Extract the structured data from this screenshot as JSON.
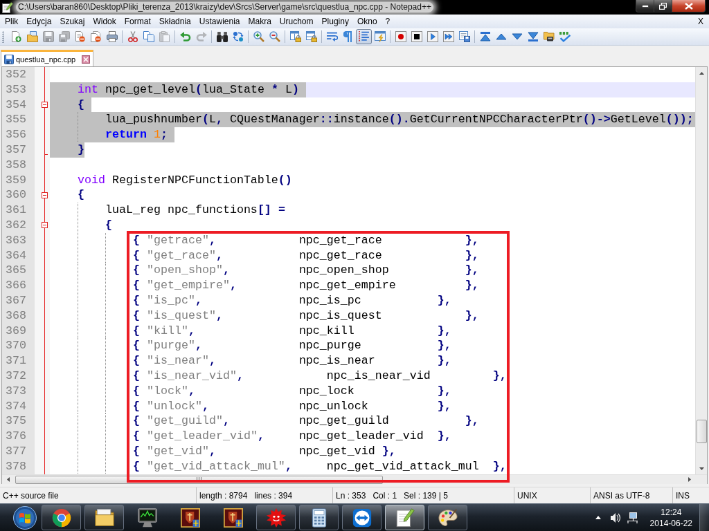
{
  "window": {
    "title": "C:\\Users\\baran860\\Desktop\\Pliki_terenza_2013\\kraizy\\dev\\Srcs\\Server\\game\\src\\questlua_npc.cpp - Notepad++"
  },
  "menu": [
    "Plik",
    "Edycja",
    "Szukaj",
    "Widok",
    "Format",
    "Składnia",
    "Ustawienia",
    "Makra",
    "Uruchom",
    "Pluginy",
    "Okno",
    "?"
  ],
  "menu_close": "X",
  "toolbar": [
    {
      "kind": "new",
      "disabled": false
    },
    {
      "kind": "open",
      "disabled": false
    },
    {
      "kind": "save",
      "disabled": true
    },
    {
      "kind": "saveall",
      "disabled": true
    },
    {
      "kind": "close",
      "disabled": false
    },
    {
      "kind": "closeall",
      "disabled": false
    },
    {
      "kind": "print",
      "disabled": false
    },
    {
      "kind": "separator"
    },
    {
      "kind": "cut",
      "disabled": false
    },
    {
      "kind": "copy",
      "disabled": false
    },
    {
      "kind": "paste",
      "disabled": true
    },
    {
      "kind": "separator"
    },
    {
      "kind": "undo",
      "disabled": false
    },
    {
      "kind": "redo",
      "disabled": true
    },
    {
      "kind": "separator"
    },
    {
      "kind": "find",
      "disabled": false
    },
    {
      "kind": "replace",
      "disabled": false
    },
    {
      "kind": "separator"
    },
    {
      "kind": "zoomin",
      "disabled": false
    },
    {
      "kind": "zoomout",
      "disabled": false
    },
    {
      "kind": "separator"
    },
    {
      "kind": "syncv",
      "disabled": false,
      "on": false
    },
    {
      "kind": "synch",
      "disabled": false,
      "on": false
    },
    {
      "kind": "separator"
    },
    {
      "kind": "wrap",
      "disabled": false,
      "on": false
    },
    {
      "kind": "allchars",
      "disabled": false,
      "on": false
    },
    {
      "kind": "indentguide",
      "disabled": false,
      "on": true
    },
    {
      "kind": "udl",
      "disabled": false
    },
    {
      "kind": "separator"
    },
    {
      "kind": "record",
      "disabled": false
    },
    {
      "kind": "stop",
      "disabled": false
    },
    {
      "kind": "play",
      "disabled": false
    },
    {
      "kind": "playmulti",
      "disabled": false
    },
    {
      "kind": "savemacro",
      "disabled": false
    },
    {
      "kind": "separator"
    },
    {
      "kind": "first",
      "disabled": false
    },
    {
      "kind": "up",
      "disabled": false
    },
    {
      "kind": "down",
      "disabled": false
    },
    {
      "kind": "last",
      "disabled": false
    },
    {
      "kind": "folder",
      "disabled": false
    },
    {
      "kind": "spell",
      "disabled": false
    }
  ],
  "tabs": [
    {
      "label": "questlua_npc.cpp",
      "selected": true,
      "modified": false
    }
  ],
  "editor": {
    "lines": [
      {
        "kind": "line",
        "number": "352",
        "current": false,
        "selected": false
      },
      {
        "kind": "line",
        "number": "353",
        "current": true,
        "selected": true,
        "segments": [
          {
            "kind": "type",
            "text": "    int"
          },
          {
            "kind": "plain",
            "text": " npc_get_level(lua_State * L)"
          }
        ]
      },
      {
        "kind": "foldstart",
        "number": "354",
        "current": false,
        "selected": true,
        "segments": [
          {
            "kind": "plain",
            "text": "    {"
          }
        ]
      },
      {
        "kind": "line",
        "number": "355",
        "current": false,
        "selected": true,
        "segments": [
          {
            "kind": "plain",
            "text": "        lua_pushnumber(L, CQuestManager::instance().GetCurrentNPCCharacterPtr()->GetLevel());"
          }
        ]
      },
      {
        "kind": "line",
        "number": "356",
        "current": false,
        "selected": true,
        "segments": [
          {
            "kind": "keyword",
            "text": "        return"
          },
          {
            "kind": "number",
            "text": " 1"
          },
          {
            "kind": "plain",
            "text": ";"
          }
        ]
      },
      {
        "kind": "foldend",
        "number": "357",
        "current": false,
        "selected": true,
        "segments": [
          {
            "kind": "plain",
            "text": "    }"
          }
        ]
      },
      {
        "kind": "line",
        "number": "358",
        "current": false,
        "selected": false
      },
      {
        "kind": "line",
        "number": "359",
        "current": false,
        "selected": false,
        "segments": [
          {
            "kind": "type",
            "text": "    void"
          },
          {
            "kind": "plain",
            "text": " RegisterNPCFunctionTable()"
          }
        ]
      },
      {
        "kind": "foldstart",
        "number": "360",
        "current": false,
        "selected": false,
        "segments": [
          {
            "kind": "plain",
            "text": "    {"
          }
        ]
      },
      {
        "kind": "line",
        "number": "361",
        "current": false,
        "selected": false,
        "segments": [
          {
            "kind": "plain",
            "text": "        luaL_reg npc_functions[] ="
          }
        ]
      },
      {
        "kind": "foldstart",
        "number": "362",
        "current": false,
        "selected": false,
        "segments": [
          {
            "kind": "plain",
            "text": "        {"
          }
        ]
      },
      {
        "kind": "highlight",
        "lines": [
          {
            "number": "363",
            "current": false,
            "selected": false,
            "segments": [
              {
                "kind": "plain",
                "text": "            { "
              },
              {
                "kind": "string",
                "text": "\"getrace\""
              },
              {
                "kind": "plain",
                "text": ","
              },
              {
                "kind": "plain",
                "text": "            npc_get_race"
              },
              {
                "kind": "plain",
                "text": "            },"
              }
            ]
          },
          {
            "number": "364",
            "current": false,
            "selected": false,
            "segments": [
              {
                "kind": "plain",
                "text": "            { "
              },
              {
                "kind": "string",
                "text": "\"get_race\""
              },
              {
                "kind": "plain",
                "text": ","
              },
              {
                "kind": "plain",
                "text": "           npc_get_race"
              },
              {
                "kind": "plain",
                "text": "            },"
              }
            ]
          },
          {
            "number": "365",
            "current": false,
            "selected": false,
            "segments": [
              {
                "kind": "plain",
                "text": "            { "
              },
              {
                "kind": "string",
                "text": "\"open_shop\""
              },
              {
                "kind": "plain",
                "text": ","
              },
              {
                "kind": "plain",
                "text": "          npc_open_shop"
              },
              {
                "kind": "plain",
                "text": "           },"
              }
            ]
          },
          {
            "number": "366",
            "current": false,
            "selected": false,
            "segments": [
              {
                "kind": "plain",
                "text": "            { "
              },
              {
                "kind": "string",
                "text": "\"get_empire\""
              },
              {
                "kind": "plain",
                "text": ","
              },
              {
                "kind": "plain",
                "text": "         npc_get_empire"
              },
              {
                "kind": "plain",
                "text": "          },"
              }
            ]
          },
          {
            "number": "367",
            "current": false,
            "selected": false,
            "segments": [
              {
                "kind": "plain",
                "text": "            { "
              },
              {
                "kind": "string",
                "text": "\"is_pc\""
              },
              {
                "kind": "plain",
                "text": ","
              },
              {
                "kind": "plain",
                "text": "              npc_is_pc"
              },
              {
                "kind": "plain",
                "text": "           },"
              }
            ]
          },
          {
            "number": "368",
            "current": false,
            "selected": false,
            "segments": [
              {
                "kind": "plain",
                "text": "            { "
              },
              {
                "kind": "string",
                "text": "\"is_quest\""
              },
              {
                "kind": "plain",
                "text": ","
              },
              {
                "kind": "plain",
                "text": "           npc_is_quest"
              },
              {
                "kind": "plain",
                "text": "            },"
              }
            ]
          },
          {
            "number": "369",
            "current": false,
            "selected": false,
            "segments": [
              {
                "kind": "plain",
                "text": "            { "
              },
              {
                "kind": "string",
                "text": "\"kill\""
              },
              {
                "kind": "plain",
                "text": ","
              },
              {
                "kind": "plain",
                "text": "               npc_kill"
              },
              {
                "kind": "plain",
                "text": "            },"
              }
            ]
          },
          {
            "number": "370",
            "current": false,
            "selected": false,
            "segments": [
              {
                "kind": "plain",
                "text": "            { "
              },
              {
                "kind": "string",
                "text": "\"purge\""
              },
              {
                "kind": "plain",
                "text": ","
              },
              {
                "kind": "plain",
                "text": "              npc_purge"
              },
              {
                "kind": "plain",
                "text": "           },"
              }
            ]
          },
          {
            "number": "371",
            "current": false,
            "selected": false,
            "segments": [
              {
                "kind": "plain",
                "text": "            { "
              },
              {
                "kind": "string",
                "text": "\"is_near\""
              },
              {
                "kind": "plain",
                "text": ","
              },
              {
                "kind": "plain",
                "text": "            npc_is_near"
              },
              {
                "kind": "plain",
                "text": "         },"
              }
            ]
          },
          {
            "number": "372",
            "current": false,
            "selected": false,
            "segments": [
              {
                "kind": "plain",
                "text": "            { "
              },
              {
                "kind": "string",
                "text": "\"is_near_vid\""
              },
              {
                "kind": "plain",
                "text": ","
              },
              {
                "kind": "plain",
                "text": "            npc_is_near_vid"
              },
              {
                "kind": "plain",
                "text": "         },"
              }
            ]
          },
          {
            "number": "373",
            "current": false,
            "selected": false,
            "segments": [
              {
                "kind": "plain",
                "text": "            { "
              },
              {
                "kind": "string",
                "text": "\"lock\""
              },
              {
                "kind": "plain",
                "text": ","
              },
              {
                "kind": "plain",
                "text": "               npc_lock"
              },
              {
                "kind": "plain",
                "text": "            },"
              }
            ]
          },
          {
            "number": "374",
            "current": false,
            "selected": false,
            "segments": [
              {
                "kind": "plain",
                "text": "            { "
              },
              {
                "kind": "string",
                "text": "\"unlock\""
              },
              {
                "kind": "plain",
                "text": ","
              },
              {
                "kind": "plain",
                "text": "             npc_unlock"
              },
              {
                "kind": "plain",
                "text": "          },"
              }
            ]
          },
          {
            "number": "375",
            "current": false,
            "selected": false,
            "segments": [
              {
                "kind": "plain",
                "text": "            { "
              },
              {
                "kind": "string",
                "text": "\"get_guild\""
              },
              {
                "kind": "plain",
                "text": ","
              },
              {
                "kind": "plain",
                "text": "          npc_get_guild"
              },
              {
                "kind": "plain",
                "text": "           },"
              }
            ]
          },
          {
            "number": "376",
            "current": false,
            "selected": false,
            "segments": [
              {
                "kind": "plain",
                "text": "            { "
              },
              {
                "kind": "string",
                "text": "\"get_leader_vid\""
              },
              {
                "kind": "plain",
                "text": ","
              },
              {
                "kind": "plain",
                "text": "     npc_get_leader_vid"
              },
              {
                "kind": "plain",
                "text": "  },"
              }
            ]
          },
          {
            "number": "377",
            "current": false,
            "selected": false,
            "segments": [
              {
                "kind": "plain",
                "text": "            { "
              },
              {
                "kind": "string",
                "text": "\"get_vid\""
              },
              {
                "kind": "plain",
                "text": ","
              },
              {
                "kind": "plain",
                "text": "            npc_get_vid"
              },
              {
                "kind": "plain",
                "text": " },"
              }
            ]
          },
          {
            "number": "378",
            "current": false,
            "selected": false,
            "segments": [
              {
                "kind": "plain",
                "text": "            { "
              },
              {
                "kind": "string",
                "text": "\"get_vid_attack_mul\""
              },
              {
                "kind": "plain",
                "text": ","
              },
              {
                "kind": "plain",
                "text": "     npc_get_vid_attack_mul"
              },
              {
                "kind": "plain",
                "text": "  },"
              }
            ]
          }
        ]
      }
    ]
  },
  "status_bar": {
    "file_type": "C++ source file",
    "length": "length : 8794",
    "lines": "lines : 394",
    "line": "Ln : 353",
    "column": "Col : 1",
    "selection": "Sel : 139 | 5",
    "eol": "UNIX",
    "encoding": "ANSI as UTF-8",
    "mode": "INS"
  },
  "taskbar": {
    "apps": [
      {
        "kind": "browser",
        "running": true,
        "selected": false
      },
      {
        "kind": "explorer",
        "running": true,
        "selected": false
      },
      {
        "kind": "monitor",
        "running": false,
        "selected": false
      },
      {
        "kind": "game",
        "running": false,
        "selected": false
      },
      {
        "kind": "game",
        "running": false,
        "selected": false
      },
      {
        "kind": "sun",
        "running": true,
        "selected": false
      },
      {
        "kind": "calculator",
        "running": true,
        "selected": false
      },
      {
        "kind": "remote",
        "running": true,
        "selected": false
      },
      {
        "kind": "editor",
        "running": true,
        "selected": true
      },
      {
        "kind": "paint",
        "running": true,
        "selected": false
      }
    ],
    "time": "12:24",
    "date": "2014-06-22"
  }
}
